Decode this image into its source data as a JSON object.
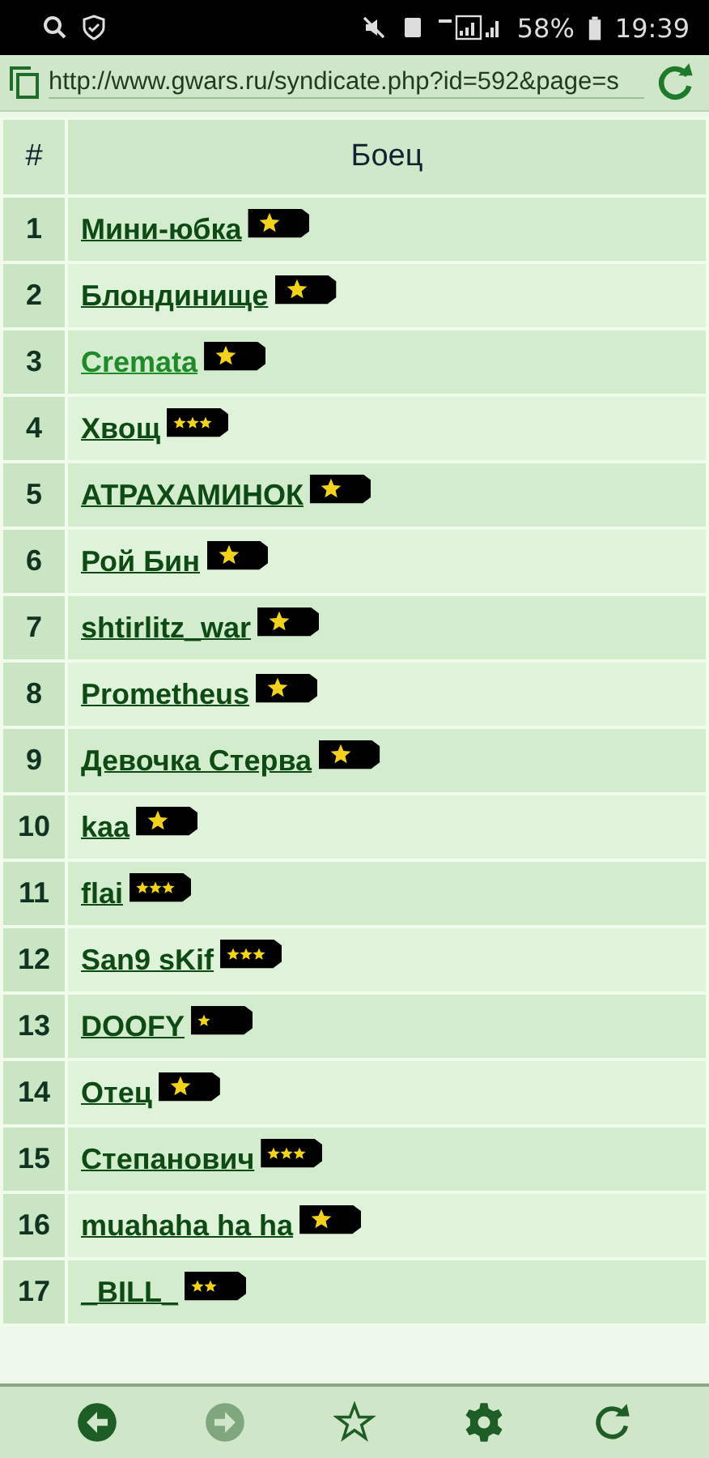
{
  "status_bar": {
    "battery": "58%",
    "time": "19:39"
  },
  "address_bar": {
    "url": "http://www.gwars.ru/syndicate.php?id=592&page=s"
  },
  "table": {
    "columns": [
      "#",
      "Боец"
    ],
    "rows": [
      {
        "number": "1",
        "name": "Мини-юбка",
        "visited": false,
        "kind": "officer"
      },
      {
        "number": "2",
        "name": "Блондинище",
        "visited": false,
        "kind": "officer"
      },
      {
        "number": "3",
        "name": "Cremata",
        "visited": true,
        "kind": "officer"
      },
      {
        "number": "4",
        "name": "Хвощ",
        "visited": false,
        "kind": "sergeant3"
      },
      {
        "number": "5",
        "name": "АТРАХАМИНОК",
        "visited": false,
        "kind": "officer"
      },
      {
        "number": "6",
        "name": "Рой Бин",
        "visited": false,
        "kind": "officer"
      },
      {
        "number": "7",
        "name": "shtirlitz_war",
        "visited": false,
        "kind": "officer"
      },
      {
        "number": "8",
        "name": "Prometheus",
        "visited": false,
        "kind": "officer"
      },
      {
        "number": "9",
        "name": "Девочка Стерва",
        "visited": false,
        "kind": "officer"
      },
      {
        "number": "10",
        "name": "kaa",
        "visited": false,
        "kind": "officer"
      },
      {
        "number": "11",
        "name": "flai",
        "visited": false,
        "kind": "sergeant3"
      },
      {
        "number": "12",
        "name": "San9 sKif",
        "visited": false,
        "kind": "sergeant3"
      },
      {
        "number": "13",
        "name": "DOOFY",
        "visited": false,
        "kind": "sergeant1"
      },
      {
        "number": "14",
        "name": "Отец",
        "visited": false,
        "kind": "officer"
      },
      {
        "number": "15",
        "name": "Степанович",
        "visited": false,
        "kind": "sergeant3"
      },
      {
        "number": "16",
        "name": "muahaha ha ha",
        "visited": false,
        "kind": "officer"
      },
      {
        "number": "17",
        "name": "_BILL_",
        "visited": false,
        "kind": "sergeant2"
      }
    ]
  },
  "toolbar": [
    {
      "kind": "back",
      "disabled": false
    },
    {
      "kind": "forward",
      "disabled": true
    },
    {
      "kind": "bookmark",
      "disabled": false
    },
    {
      "kind": "settings",
      "disabled": false
    },
    {
      "kind": "reload",
      "disabled": false
    }
  ]
}
